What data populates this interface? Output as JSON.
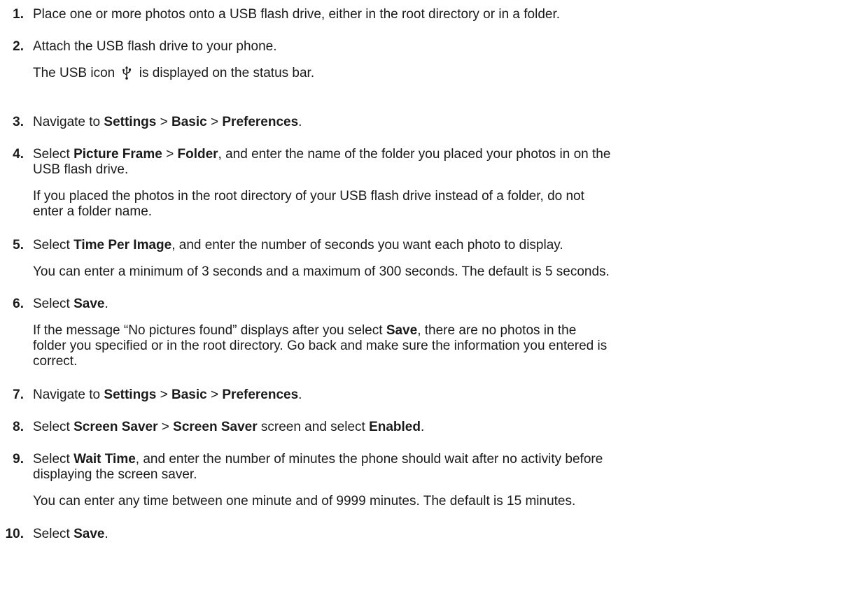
{
  "steps": [
    {
      "num": "1.",
      "text": "Place one or more photos onto a USB flash drive, either in the root directory or in a folder."
    },
    {
      "num": "2.",
      "text": "Attach the USB flash drive to your phone.",
      "note_before": "The USB icon",
      "note_icon": "usb-icon",
      "note_after": "is displayed on the status bar."
    },
    {
      "num": "3.",
      "parts": [
        "Navigate to ",
        "Settings",
        " > ",
        "Basic",
        " > ",
        "Preferences",
        "."
      ]
    },
    {
      "num": "4.",
      "parts": [
        "Select ",
        "Picture Frame",
        " > ",
        "Folder",
        ", and enter the name of the folder you placed your photos in on the"
      ],
      "line2": "USB flash drive.",
      "note_l1": "If you placed the photos in the root directory of your USB flash drive instead of a folder, do not",
      "note_l2": "enter a folder name."
    },
    {
      "num": "5.",
      "parts": [
        "Select ",
        "Time Per Image",
        ", and enter the number of seconds you want each photo to display."
      ],
      "note": "You can enter a minimum of 3 seconds and a maximum of 300 seconds. The default is 5 seconds."
    },
    {
      "num": "6.",
      "parts": [
        "Select ",
        "Save",
        "."
      ],
      "note_parts": [
        "If the message “No pictures found” displays after you select ",
        "Save",
        ", there are no photos in the"
      ],
      "note_l2": "folder you specified or in the root directory. Go back and make sure the information you entered is",
      "note_l3": "correct."
    },
    {
      "num": "7.",
      "parts": [
        "Navigate to ",
        "Settings",
        " > ",
        "Basic",
        " > ",
        "Preferences",
        "."
      ]
    },
    {
      "num": "8.",
      "parts": [
        "Select ",
        "Screen Saver",
        " > ",
        "Screen Saver",
        " screen and select ",
        "Enabled",
        "."
      ]
    },
    {
      "num": "9.",
      "parts": [
        "Select ",
        "Wait Time",
        ", and enter the number of minutes the phone should wait after no activity before"
      ],
      "line2": "displaying the screen saver.",
      "note": "You can enter any time between one minute and of 9999 minutes. The default is 15 minutes."
    },
    {
      "num": "10.",
      "parts": [
        "Select ",
        "Save",
        "."
      ]
    }
  ]
}
